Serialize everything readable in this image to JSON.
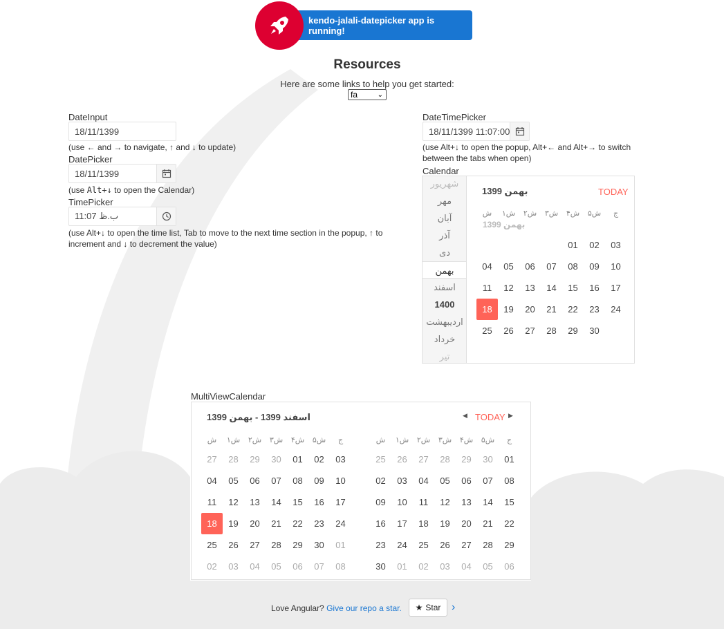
{
  "toolbar": {
    "running_text": "kendo-jalali-datepicker app is running!"
  },
  "resources": {
    "title": "Resources",
    "subtitle": "Here are some links to help you get started:",
    "lang_value": "fa"
  },
  "dateinput": {
    "label": "DateInput",
    "value": "18/11/1399",
    "hint": "(use ← and → to navigate, ↑ and ↓ to update)"
  },
  "datepicker": {
    "label": "DatePicker",
    "value": "18/11/1399",
    "hint_pre": "(use ",
    "hint_kbd": "Alt+↓",
    "hint_post": " to open the Calendar)"
  },
  "timepicker": {
    "label": "TimePicker",
    "value": "ب.ظ 11:07",
    "hint_line1": "(use Alt+↓ to open the time list, Tab to move to the next time section in the popup, ↑ to",
    "hint_line2": "increment and ↓ to decrement the value)"
  },
  "datetimepicker": {
    "label": "DateTimePicker",
    "value": "18/11/1399 11:07:00",
    "hint_line1": "(use Alt+↓ to open the popup, Alt+← and Alt+→ to switch",
    "hint_line2": "between the tabs when open)"
  },
  "calendar": {
    "label": "Calendar",
    "header": "بهمن 1399",
    "today": "TODAY",
    "ghost_month": "بهمن 1399",
    "nav": [
      {
        "label": "شهریور",
        "state": "faded"
      },
      {
        "label": "مهر",
        "state": "normal"
      },
      {
        "label": "آبان",
        "state": "normal"
      },
      {
        "label": "آذر",
        "state": "normal"
      },
      {
        "label": "دی",
        "state": "normal"
      },
      {
        "label": "بهمن",
        "state": "sel"
      },
      {
        "label": "اسفند",
        "state": "normal"
      },
      {
        "label": "1400",
        "state": "year"
      },
      {
        "label": "اردیبهشت",
        "state": "normal"
      },
      {
        "label": "خرداد",
        "state": "normal"
      },
      {
        "label": "تیر",
        "state": "faded"
      }
    ],
    "weekdays": [
      "ج",
      "ش۵",
      "ش۴",
      "ش۳",
      "ش۲",
      "ش۱",
      "ش"
    ],
    "weeks": [
      [
        "03",
        "02",
        "01",
        "",
        "",
        "",
        ""
      ],
      [
        "10",
        "09",
        "08",
        "07",
        "06",
        "05",
        "04"
      ],
      [
        "17",
        "16",
        "15",
        "14",
        "13",
        "12",
        "11"
      ],
      [
        "24",
        "23",
        "22",
        "21",
        "20",
        "19",
        "18"
      ],
      [
        "",
        "30",
        "29",
        "28",
        "27",
        "26",
        "25"
      ]
    ],
    "selected": "18"
  },
  "multiview": {
    "label": "MultiViewCalendar",
    "header": "اسفند 1399 - بهمن 1399",
    "today": "TODAY",
    "weekdays": [
      "ش",
      "ش۱",
      "ش۲",
      "ش۳",
      "ش۴",
      "ش۵",
      "ج"
    ],
    "left_weeks": [
      [
        "27",
        "28",
        "29",
        "30",
        "01",
        "02",
        "03"
      ],
      [
        "04",
        "05",
        "06",
        "07",
        "08",
        "09",
        "10"
      ],
      [
        "11",
        "12",
        "13",
        "14",
        "15",
        "16",
        "17"
      ],
      [
        "18",
        "19",
        "20",
        "21",
        "22",
        "23",
        "24"
      ],
      [
        "25",
        "26",
        "27",
        "28",
        "29",
        "30",
        "01"
      ],
      [
        "02",
        "03",
        "04",
        "05",
        "06",
        "07",
        "08"
      ]
    ],
    "left_other": [
      [
        0,
        1,
        2,
        3
      ],
      [],
      [],
      [],
      [
        6
      ],
      [
        0,
        1,
        2,
        3,
        4,
        5,
        6
      ]
    ],
    "right_weeks": [
      [
        "25",
        "26",
        "27",
        "28",
        "29",
        "30",
        "01"
      ],
      [
        "02",
        "03",
        "04",
        "05",
        "06",
        "07",
        "08"
      ],
      [
        "09",
        "10",
        "11",
        "12",
        "13",
        "14",
        "15"
      ],
      [
        "16",
        "17",
        "18",
        "19",
        "20",
        "21",
        "22"
      ],
      [
        "23",
        "24",
        "25",
        "26",
        "27",
        "28",
        "29"
      ],
      [
        "30",
        "01",
        "02",
        "03",
        "04",
        "05",
        "06"
      ]
    ],
    "right_other": [
      [
        0,
        1,
        2,
        3,
        4,
        5
      ],
      [],
      [],
      [],
      [],
      [
        1,
        2,
        3,
        4,
        5,
        6
      ]
    ],
    "selected_left": "18"
  },
  "footer": {
    "love": "Love Angular?",
    "link": "Give our repo a star.",
    "star": "Star"
  },
  "colors": {
    "brand_red": "#dd0031",
    "brand_blue": "#1976d2",
    "accent": "#ff6358"
  }
}
